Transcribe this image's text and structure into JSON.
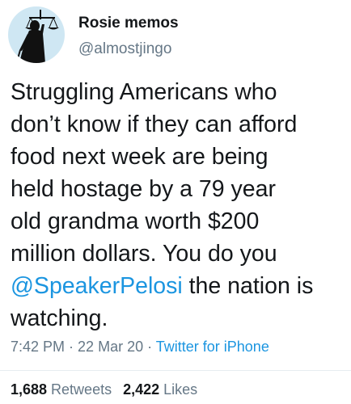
{
  "user": {
    "display_name": "Rosie memos",
    "handle": "@almostjingo",
    "avatar_icon": "lady-justice-silhouette-icon",
    "avatar_bg": "#cfe7f3"
  },
  "tweet": {
    "lines": [
      "Struggling Americans who",
      "don’t know if they can afford",
      "food next week are being",
      "held hostage by a 79 year",
      "old grandma worth $200",
      "million dollars. You do you"
    ],
    "mention": "@SpeakerPelosi",
    "after_mention": " the nation is",
    "last_line": "watching."
  },
  "meta": {
    "time": "7:42 PM",
    "sep1": " · ",
    "date": "22 Mar 20",
    "sep2": " · ",
    "source": "Twitter for iPhone"
  },
  "stats": {
    "retweets_count": "1,688",
    "retweets_label": " Retweets",
    "likes_count": "2,422",
    "likes_label": " Likes"
  },
  "colors": {
    "text": "#14171a",
    "muted": "#657786",
    "link": "#1b95e0"
  }
}
